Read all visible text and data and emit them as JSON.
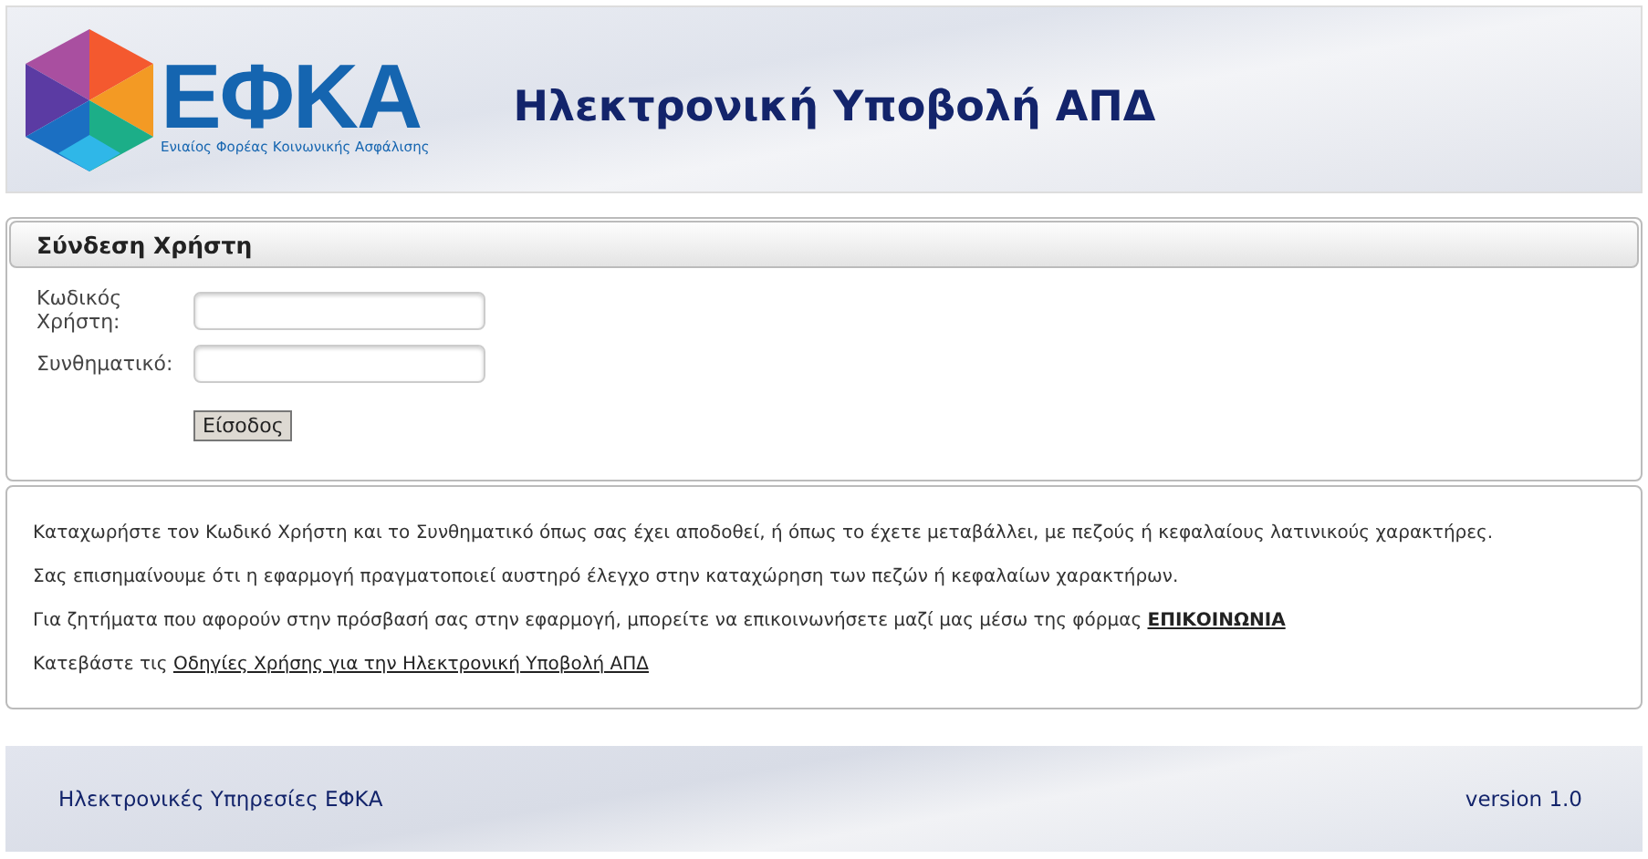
{
  "header": {
    "logo_text": "ΕΦΚΑ",
    "logo_subtitle": "Ενιαίος Φορέας Κοινωνικής Ασφάλισης",
    "title": "Ηλεκτρονική Υποβολή ΑΠΔ"
  },
  "login": {
    "title": "Σύνδεση Χρήστη",
    "fields": [
      {
        "label": "Κωδικός Χρήστη:"
      },
      {
        "label": "Συνθηματικό:"
      }
    ],
    "button": "Είσοδος"
  },
  "info": [
    {
      "text": "Καταχωρήστε τον Κωδικό Χρήστη και το Συνθηματικό όπως σας έχει αποδοθεί, ή όπως το έχετε μεταβάλλει, με πεζούς ή κεφαλαίους λατινικούς χαρακτήρες."
    },
    {
      "text": "Σας επισημαίνουμε ότι η εφαρμογή πραγματοποιεί αυστηρό έλεγχο στην καταχώρηση των πεζών ή κεφαλαίων χαρακτήρων."
    },
    {
      "text": "Για ζητήματα που αφορούν στην πρόσβασή σας στην εφαρμογή, μπορείτε να επικοινωνήσετε μαζί μας μέσω της φόρμας ",
      "link": "ΕΠΙΚΟΙΝΩΝΙΑ",
      "link_bold": true
    },
    {
      "text": "Κατεβάστε τις ",
      "link": "Οδηγίες Χρήσης για την Ηλεκτρονική Υποβολή ΑΠΔ",
      "link_bold": false
    }
  ],
  "footer": {
    "left": "Ηλεκτρονικές Υπηρεσίες ΕΦΚΑ",
    "right": "version 1.0"
  }
}
